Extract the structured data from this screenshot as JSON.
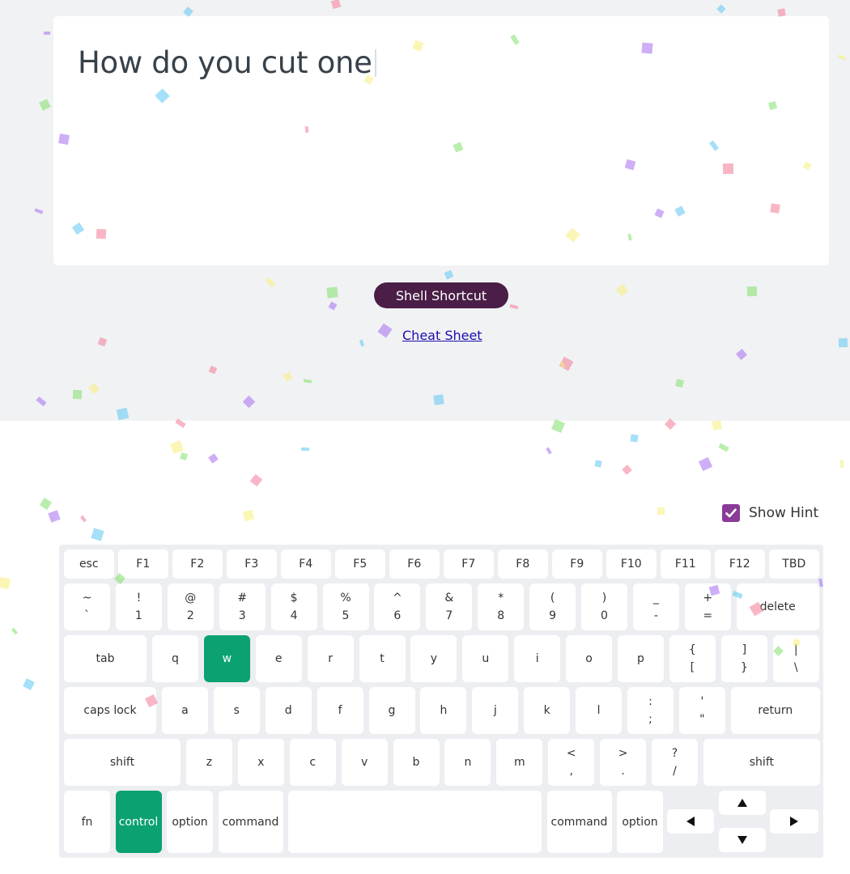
{
  "question": {
    "text": "How do you cut one"
  },
  "actions": {
    "shell_shortcut_label": "Shell Shortcut",
    "cheat_sheet_label": "Cheat Sheet"
  },
  "hint": {
    "label": "Show Hint",
    "checked": true
  },
  "colors": {
    "accent_button": "#4a1e47",
    "pressed_key": "#0ba172",
    "checkbox": "#8a3b97",
    "link": "#1a0dab"
  },
  "keyboard": {
    "row1": [
      "esc",
      "F1",
      "F2",
      "F3",
      "F4",
      "F5",
      "F6",
      "F7",
      "F8",
      "F9",
      "F10",
      "F11",
      "F12",
      "TBD"
    ],
    "row2": [
      [
        "~",
        "`"
      ],
      [
        "!",
        "1"
      ],
      [
        "@",
        "2"
      ],
      [
        "#",
        "3"
      ],
      [
        "$",
        "4"
      ],
      [
        "%",
        "5"
      ],
      [
        "^",
        "6"
      ],
      [
        "&",
        "7"
      ],
      [
        "*",
        "8"
      ],
      [
        "(",
        "9"
      ],
      [
        ")",
        "0"
      ],
      [
        "_",
        "-"
      ],
      [
        "+",
        "="
      ],
      "delete"
    ],
    "row3": [
      "tab",
      "q",
      "w",
      "e",
      "r",
      "t",
      "y",
      "u",
      "i",
      "o",
      "p",
      [
        "{",
        "["
      ],
      [
        "]",
        "}"
      ],
      [
        "|",
        "\\"
      ]
    ],
    "row4": [
      "caps lock",
      "a",
      "s",
      "d",
      "f",
      "g",
      "h",
      "j",
      "k",
      "l",
      [
        ":",
        ";"
      ],
      [
        "'",
        "\""
      ],
      "return"
    ],
    "row5": [
      "shift",
      "z",
      "x",
      "c",
      "v",
      "b",
      "n",
      "m",
      [
        "<",
        ","
      ],
      [
        ">",
        "."
      ],
      [
        "?",
        "/"
      ],
      "shift"
    ],
    "row6": [
      "fn",
      "control",
      "option",
      "command",
      "",
      "command",
      "option"
    ],
    "arrows": {
      "up": "up-arrow-icon",
      "left": "left-arrow-icon",
      "down": "down-arrow-icon",
      "right": "right-arrow-icon"
    },
    "pressed": [
      "w",
      "control"
    ]
  }
}
